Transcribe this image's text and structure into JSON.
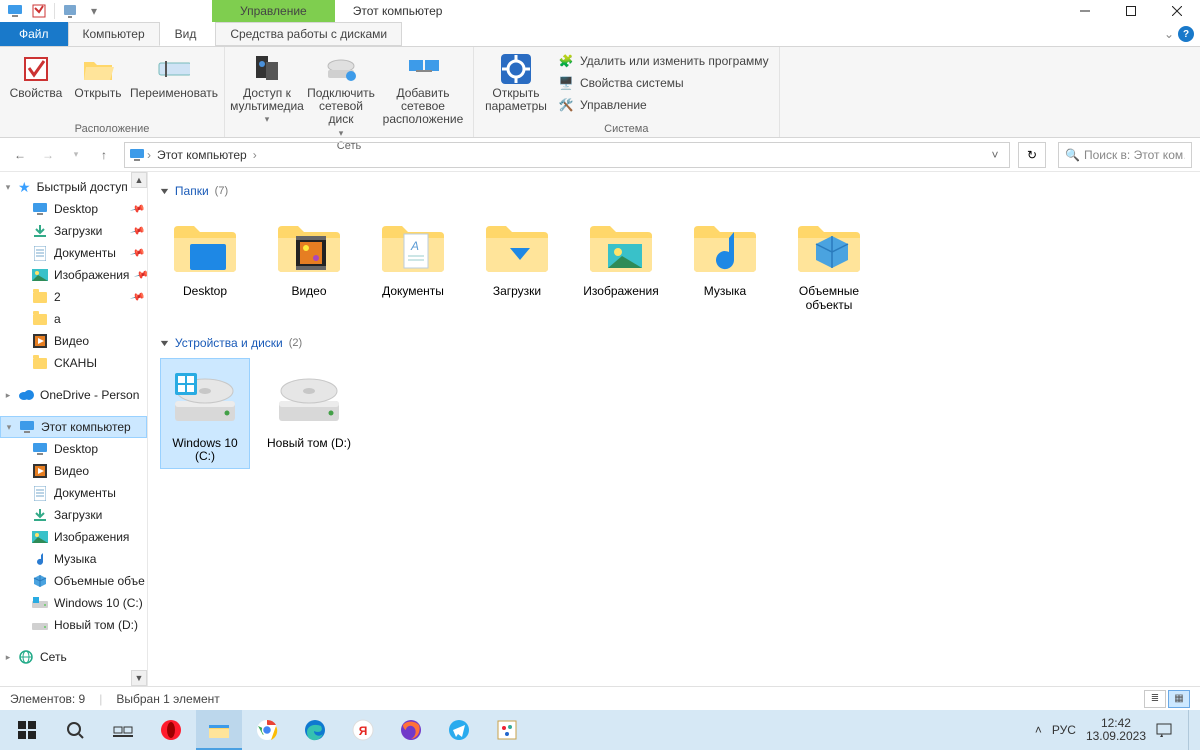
{
  "title": "Этот компьютер",
  "ribbon_context_tab": "Управление",
  "tabs": {
    "file": "Файл",
    "computer": "Компьютер",
    "view": "Вид",
    "disk_tools": "Средства работы с дисками"
  },
  "ribbon": {
    "loc_group": "Расположение",
    "net_group": "Сеть",
    "sys_group": "Система",
    "props": "Свойства",
    "open": "Открыть",
    "rename": "Переименовать",
    "media": "Доступ к мультимедиа",
    "mapdrive": "Подключить сетевой диск",
    "addnet": "Добавить сетевое расположение",
    "open_params": "Открыть параметры",
    "uninstall": "Удалить или изменить программу",
    "sysprops": "Свойства системы",
    "manage": "Управление"
  },
  "breadcrumb": {
    "root": "Этот компьютер"
  },
  "search_placeholder": "Поиск в: Этот ком…",
  "sidebar": {
    "quick": "Быстрый доступ",
    "items": [
      {
        "label": "Desktop",
        "pin": true,
        "icon": "desktop"
      },
      {
        "label": "Загрузки",
        "pin": true,
        "icon": "downloads"
      },
      {
        "label": "Документы",
        "pin": true,
        "icon": "docs"
      },
      {
        "label": "Изображения",
        "pin": true,
        "icon": "pics"
      },
      {
        "label": "2",
        "pin": true,
        "icon": "folder"
      },
      {
        "label": "a",
        "pin": false,
        "icon": "folder"
      },
      {
        "label": "Видео",
        "pin": false,
        "icon": "video"
      },
      {
        "label": "СКАНЫ",
        "pin": false,
        "icon": "folder"
      }
    ],
    "onedrive": "OneDrive - Person",
    "thispc": "Этот компьютер",
    "pc_children": [
      "Desktop",
      "Видео",
      "Документы",
      "Загрузки",
      "Изображения",
      "Музыка",
      "Объемные объе",
      "Windows 10 (C:)",
      "Новый том (D:)"
    ],
    "network": "Сеть"
  },
  "groups": {
    "folders_hdr": "Папки",
    "folders_cnt": "(7)",
    "drives_hdr": "Устройства и диски",
    "drives_cnt": "(2)"
  },
  "folders": [
    {
      "label": "Desktop",
      "icon": "desktop"
    },
    {
      "label": "Видео",
      "icon": "video"
    },
    {
      "label": "Документы",
      "icon": "docs"
    },
    {
      "label": "Загрузки",
      "icon": "downloads"
    },
    {
      "label": "Изображения",
      "icon": "pics"
    },
    {
      "label": "Музыка",
      "icon": "music"
    },
    {
      "label": "Объемные объекты",
      "icon": "3d"
    }
  ],
  "drives": [
    {
      "label": "Windows 10 (C:)",
      "os": true,
      "selected": true
    },
    {
      "label": "Новый том (D:)",
      "os": false,
      "selected": false
    }
  ],
  "status": {
    "count": "Элементов: 9",
    "sel": "Выбран 1 элемент"
  },
  "tray": {
    "lang": "РУС",
    "time": "12:42",
    "date": "13.09.2023"
  }
}
